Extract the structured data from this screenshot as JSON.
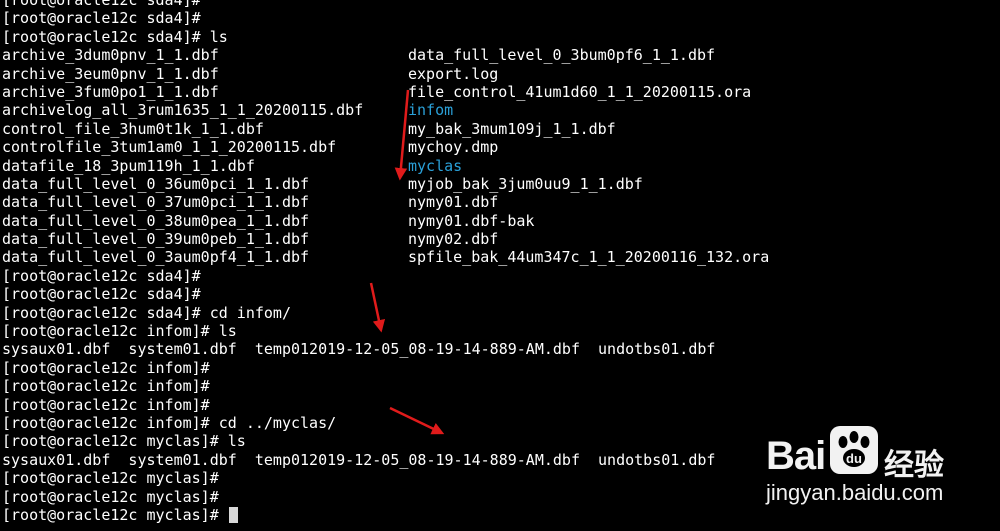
{
  "terminal": {
    "lines": [
      {
        "c1": "[root@oracle12c sda4]#",
        "c2": ""
      },
      {
        "c1": "[root@oracle12c sda4]#",
        "c2": ""
      },
      {
        "c1": "[root@oracle12c sda4]# ls",
        "c2": ""
      },
      {
        "c1": "archive_3dum0pnv_1_1.dbf",
        "c2": "data_full_level_0_3bum0pf6_1_1.dbf"
      },
      {
        "c1": "archive_3eum0pnv_1_1.dbf",
        "c2": "export.log"
      },
      {
        "c1": "archive_3fum0po1_1_1.dbf",
        "c2": "file_control_41um1d60_1_1_20200115.ora"
      },
      {
        "c1": "archivelog_all_3rum1635_1_1_20200115.dbf",
        "c2": "infom",
        "c2_dir": true
      },
      {
        "c1": "control_file_3hum0t1k_1_1.dbf",
        "c2": "my_bak_3mum109j_1_1.dbf"
      },
      {
        "c1": "controlfile_3tum1am0_1_1_20200115.dbf",
        "c2": "mychoy.dmp"
      },
      {
        "c1": "datafile_18_3pum119h_1_1.dbf",
        "c2": "myclas",
        "c2_dir": true
      },
      {
        "c1": "data_full_level_0_36um0pci_1_1.dbf",
        "c2": "myjob_bak_3jum0uu9_1_1.dbf"
      },
      {
        "c1": "data_full_level_0_37um0pci_1_1.dbf",
        "c2": "nymy01.dbf"
      },
      {
        "c1": "data_full_level_0_38um0pea_1_1.dbf",
        "c2": "nymy01.dbf-bak"
      },
      {
        "c1": "data_full_level_0_39um0peb_1_1.dbf",
        "c2": "nymy02.dbf"
      },
      {
        "c1": "data_full_level_0_3aum0pf4_1_1.dbf",
        "c2": "spfile_bak_44um347c_1_1_20200116_132.ora"
      },
      {
        "c1": "[root@oracle12c sda4]#",
        "c2": ""
      },
      {
        "c1": "[root@oracle12c sda4]#",
        "c2": ""
      },
      {
        "c1": "[root@oracle12c sda4]# cd infom/",
        "c2": ""
      },
      {
        "c1": "[root@oracle12c infom]# ls",
        "c2": ""
      },
      {
        "c1": "sysaux01.dbf  system01.dbf  temp012019-12-05_08-19-14-889-AM.dbf  undotbs01.dbf",
        "c2": ""
      },
      {
        "c1": "[root@oracle12c infom]#",
        "c2": ""
      },
      {
        "c1": "[root@oracle12c infom]#",
        "c2": ""
      },
      {
        "c1": "[root@oracle12c infom]#",
        "c2": ""
      },
      {
        "c1": "[root@oracle12c infom]# cd ../myclas/",
        "c2": ""
      },
      {
        "c1": "[root@oracle12c myclas]# ls",
        "c2": ""
      },
      {
        "c1": "sysaux01.dbf  system01.dbf  temp012019-12-05_08-19-14-889-AM.dbf  undotbs01.dbf",
        "c2": ""
      },
      {
        "c1": "[root@oracle12c myclas]#",
        "c2": ""
      },
      {
        "c1": "[root@oracle12c myclas]#",
        "c2": ""
      },
      {
        "c1": "[root@oracle12c myclas]# ",
        "c2": "",
        "cursor": true
      }
    ]
  },
  "annotations": {
    "arrow_color": "#e01b1b",
    "arrow_count": 3
  },
  "watermark": {
    "brand_latin": "Bai",
    "brand_icon": "paw-icon",
    "brand_cn": "经验",
    "url": "jingyan.baidu.com"
  },
  "colors": {
    "background": "#000000",
    "text": "#ffffff",
    "directory": "#2aa0d8",
    "cursor": "#d8d8d8"
  }
}
